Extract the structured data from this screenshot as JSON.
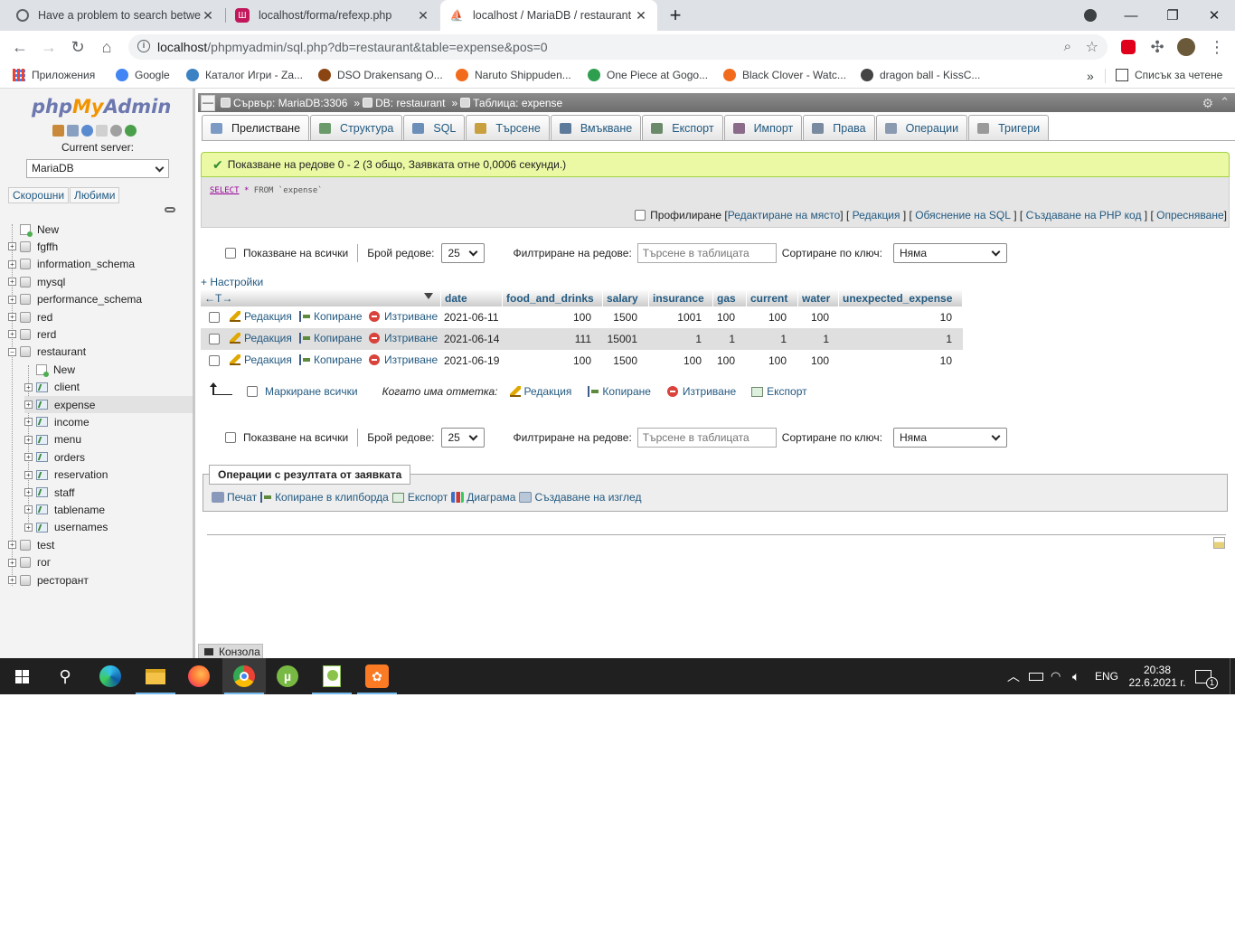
{
  "browser": {
    "tabs": [
      {
        "title": "Have a problem to search betwe",
        "favicon_color": "#5f6368",
        "active": false
      },
      {
        "title": "localhost/forma/refexp.php",
        "favicon_color": "#c2185b",
        "active": false
      },
      {
        "title": "localhost / MariaDB / restaurant",
        "favicon_color": "#f29400",
        "active": true
      }
    ],
    "new_tab": "+",
    "window_controls": {
      "minimize": "—",
      "restore": "❐",
      "close": "✕"
    },
    "url_host": "localhost",
    "url_path": "/phpmyadmin/sql.php?db=restaurant&table=expense&pos=0",
    "bookmarks": [
      {
        "label": "Приложения",
        "color": "#ea4335"
      },
      {
        "label": "Google",
        "color": "#4285f4"
      },
      {
        "label": "Каталог Игри - Za...",
        "color": "#3b82c4"
      },
      {
        "label": "DSO Drakensang O...",
        "color": "#8b4513"
      },
      {
        "label": "Naruto Shippuden...",
        "color": "#f26b1d"
      },
      {
        "label": "One Piece at Gogo...",
        "color": "#2e9e4f"
      },
      {
        "label": "Black Clover - Watc...",
        "color": "#f26b1d"
      },
      {
        "label": "dragon ball - KissC...",
        "color": "#444444"
      }
    ],
    "bookmarks_more": "»",
    "reading_list": "Списък за четене"
  },
  "pma_nav": {
    "logo_php": "php",
    "logo_my": "My",
    "logo_admin": "Admin",
    "current_server_label": "Current server:",
    "server_value": "MariaDB",
    "tab_recent": "Скорошни",
    "tab_favorites": "Любими",
    "tree": [
      {
        "label": "New",
        "kind": "new"
      },
      {
        "label": "fgffh",
        "kind": "db"
      },
      {
        "label": "information_schema",
        "kind": "db"
      },
      {
        "label": "mysql",
        "kind": "db"
      },
      {
        "label": "performance_schema",
        "kind": "db"
      },
      {
        "label": "red",
        "kind": "db"
      },
      {
        "label": "rerd",
        "kind": "db"
      },
      {
        "label": "restaurant",
        "kind": "db-open"
      },
      {
        "label": "New",
        "kind": "table-new"
      },
      {
        "label": "client",
        "kind": "table"
      },
      {
        "label": "expense",
        "kind": "table",
        "selected": true
      },
      {
        "label": "income",
        "kind": "table"
      },
      {
        "label": "menu",
        "kind": "table"
      },
      {
        "label": "orders",
        "kind": "table"
      },
      {
        "label": "reservation",
        "kind": "table"
      },
      {
        "label": "staff",
        "kind": "table"
      },
      {
        "label": "tablename",
        "kind": "table"
      },
      {
        "label": "usernames",
        "kind": "table"
      },
      {
        "label": "test",
        "kind": "db"
      },
      {
        "label": "гог",
        "kind": "db"
      },
      {
        "label": "ресторант",
        "kind": "db"
      }
    ]
  },
  "breadcrumb": {
    "server": "Сървър: MariaDB:3306",
    "db": "DB: restaurant",
    "table": "Таблица: expense",
    "sep": "»"
  },
  "menu_tabs": [
    {
      "label": "Прелистване",
      "icon_color": "#7b9bc4",
      "active": true
    },
    {
      "label": "Структура",
      "icon_color": "#6a9a6a"
    },
    {
      "label": "SQL",
      "icon_color": "#6b8fb8"
    },
    {
      "label": "Търсене",
      "icon_color": "#c8a040"
    },
    {
      "label": "Вмъкване",
      "icon_color": "#5d7a9a"
    },
    {
      "label": "Експорт",
      "icon_color": "#6b8a6b"
    },
    {
      "label": "Импорт",
      "icon_color": "#8a6b8a"
    },
    {
      "label": "Права",
      "icon_color": "#7a8aa0"
    },
    {
      "label": "Операции",
      "icon_color": "#8a9ab0"
    },
    {
      "label": "Тригери",
      "icon_color": "#9a9a9a"
    }
  ],
  "query_result": {
    "success_message": "Показване на редове 0 - 2 (3 общо, Заявката отне 0,0006 секунди.)",
    "sql_select": "SELECT",
    "sql_star": "*",
    "sql_from": "FROM",
    "sql_table": "`expense`",
    "profiling": "Профилиране",
    "link_inline_edit": "Редактиране на място",
    "link_edit": "Редакция",
    "link_explain": "Обяснение на SQL",
    "link_php": "Създаване на PHP код",
    "link_refresh": "Опресняване"
  },
  "nav_controls": {
    "show_all": "Показване на всички",
    "rows_label": "Брой редове:",
    "rows_value": "25",
    "filter_label": "Филтриране на редове:",
    "filter_placeholder": "Търсене в таблицата",
    "sort_label": "Сортиране по ключ:",
    "sort_value": "Няма"
  },
  "settings_link": "+ Настройки",
  "grid": {
    "arrows": "←T→",
    "columns": [
      "date",
      "food_and_drinks",
      "salary",
      "insurance",
      "gas",
      "current",
      "water",
      "unexpected_expense"
    ],
    "actions": {
      "edit": "Редакция",
      "copy": "Копиране",
      "delete": "Изтриване"
    },
    "rows": [
      [
        "2021-06-11",
        "100",
        "1500",
        "1001",
        "100",
        "100",
        "100",
        "10"
      ],
      [
        "2021-06-14",
        "111",
        "15001",
        "1",
        "1",
        "1",
        "1",
        "1"
      ],
      [
        "2021-06-19",
        "100",
        "1500",
        "100",
        "100",
        "100",
        "100",
        "10"
      ]
    ]
  },
  "bulk": {
    "check_all": "Маркиране всички",
    "with_selected": "Когато има отметка:",
    "edit": "Редакция",
    "copy": "Копиране",
    "delete": "Изтриване",
    "export": "Експорт"
  },
  "result_ops": {
    "legend": "Операции с резултата от заявката",
    "print": "Печат",
    "copy_clipboard": "Копиране в клипборда",
    "export": "Експорт",
    "chart": "Диаграма",
    "create_view": "Създаване на изглед"
  },
  "console_label": "Конзола",
  "taskbar": {
    "lang": "ENG",
    "time": "20:38",
    "date": "22.6.2021 г.",
    "notifications": "1"
  }
}
